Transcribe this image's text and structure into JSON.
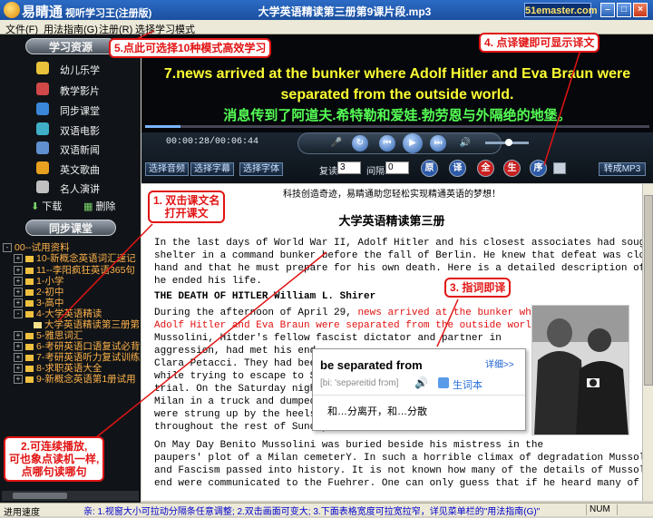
{
  "titlebar": {
    "app_name": "易睛通",
    "app_subtitle": "视听学习王(注册版)",
    "window_title": "大学英语精读第三册第9课片段.mp3",
    "site": "51emaster.com"
  },
  "menu": [
    "文件(F)",
    "用法指南(G)",
    "注册(R)",
    "选择学习模式"
  ],
  "left_panel": {
    "section1_title": "学习资源",
    "nav_items": [
      {
        "label": "幼儿乐学",
        "icon": "kids-icon",
        "color": "#e8c23a"
      },
      {
        "label": "教学影片",
        "icon": "film-icon",
        "color": "#d04848"
      },
      {
        "label": "同步课堂",
        "icon": "classroom-icon",
        "color": "#3a86d8"
      },
      {
        "label": "双语电影",
        "icon": "movie-icon",
        "color": "#40b0c8"
      },
      {
        "label": "双语新闻",
        "icon": "news-icon",
        "color": "#6090d0"
      },
      {
        "label": "英文歌曲",
        "icon": "music-icon",
        "color": "#e8a020"
      },
      {
        "label": "名人演讲",
        "icon": "speech-icon",
        "color": "#c0c0c0"
      }
    ],
    "download_label": "下载",
    "delete_label": "删除",
    "section2_title": "同步课堂",
    "tree": [
      {
        "label": "00--试用资料",
        "type": "folder"
      },
      {
        "label": "10-新概念英语词汇速记",
        "type": "expand"
      },
      {
        "label": "11--李阳疯狂英语365句",
        "type": "expand"
      },
      {
        "label": "1-小学",
        "type": "expand"
      },
      {
        "label": "2-初中",
        "type": "expand"
      },
      {
        "label": "3-高中",
        "type": "expand"
      },
      {
        "label": "4-大学英语精读",
        "type": "collapse"
      },
      {
        "label": "大学英语精读第三册第",
        "type": "file"
      },
      {
        "label": "5-雅思词汇",
        "type": "expand"
      },
      {
        "label": "6-考研英语口语复试必背",
        "type": "expand"
      },
      {
        "label": "7-考研英语听力复试训练",
        "type": "expand"
      },
      {
        "label": "8-求职英语大全",
        "type": "expand"
      },
      {
        "label": "9-新概念英语第1册试用",
        "type": "expand"
      }
    ]
  },
  "display": {
    "subtitle_en": "7.news arrived at the bunker where Adolf Hitler and Eva Braun were separated from the outside world.",
    "subtitle_cn": "消息传到了阿道夫.希特勒和爱娃.勃劳恩与外隔绝的地堡。",
    "time": "00:00:28/00:06:44",
    "progress_pct": 7,
    "volume_pct": 55
  },
  "controls": {
    "select_audio": "选择音频",
    "select_subtitle": "选择字幕",
    "select_font": "选择字体",
    "repeat_label": "复读",
    "repeat_value": "3",
    "interval_label": "间隔",
    "interval_value": "0",
    "round_buttons": [
      {
        "label": "原",
        "color": "#2d5aa8"
      },
      {
        "label": "译",
        "color": "#2d5aa8"
      },
      {
        "label": "全",
        "color": "#c82020"
      },
      {
        "label": "生",
        "color": "#c82020"
      },
      {
        "label": "序",
        "color": "#2d5aa8"
      }
    ],
    "convert_mp3": "转成MP3"
  },
  "text": {
    "slogan": "科技创造奇迹，易睛通助您轻松实现精通英语的梦想！",
    "title": "大学英语精读第三册",
    "lines": [
      "In the last days of World War II, Adolf Hitler and his closest associates had sought",
      "shelter in a command bunker before the fall of Berlin. He knew that defeat was close at",
      "hand and that he must prepare for his own death. Here is a detailed description of how",
      "he ended his life."
    ],
    "heading": "THE DEATH OF HITLER William L. Shirer",
    "para2_start": "During the afternoon of April 29, ",
    "para2_red1": "news arrived at the bunker where",
    "para2_red2": "Adolf Hitler and Eva Braun were separated from the outside world.",
    "para2_lines": [
      "Mussolini, Hitder's fellow fascist dictator and partner in",
      "aggression, had met his end,",
      "Clara Petacci. They had been",
      "while trying to escape to Swi",
      "trial. On the Saturday night",
      "Milan in a truck and dumped o",
      "were strung up by the heels f",
      "throughout the rest of Sunday"
    ],
    "para3": [
      "On May Day Benito Mussolini was buried beside his mistress in the",
      "paupers' plot of a Milan cemeterY. In such a horrible climax of degradation Mussolini",
      "and Fascism passed into history. It is not known how many of the details of Mussolini's",
      "end were communicated to the Fuehrer. One can only guess that if he heard many of"
    ]
  },
  "popup": {
    "word": "be separated from",
    "detail_link": "详细>>",
    "phonetic": "[bi: 'sepəreitid frɔm]",
    "wordbook": "生词本",
    "meaning": "和…分离开，和…分散"
  },
  "callouts": {
    "c1": "1. 双击课文名\n打开课文",
    "c2": "2.可连续播放,\n可也象点读机一样,\n点哪句读哪句",
    "c3": "3. 指词即译",
    "c4": "4. 点译键即可显示译文",
    "c5": "5.点此可选择10种模式高效学习"
  },
  "status": {
    "left": "进用速度",
    "tip": "亲: 1.视窗大小可拉动分隔条任意调整; 2.双击画面可变大; 3.下面表格宽度可拉宽拉窄，详见菜单栏的\"用法指南(G)\"",
    "num": "NUM"
  }
}
